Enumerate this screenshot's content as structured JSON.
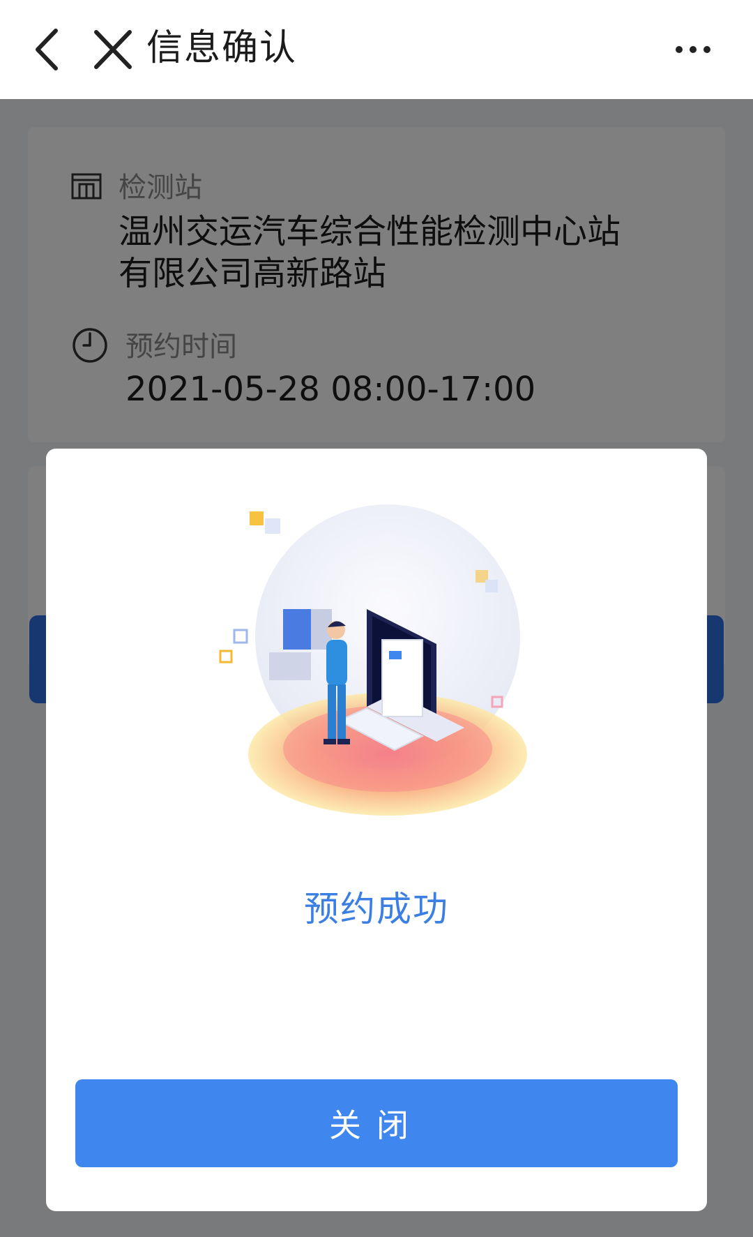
{
  "navbar": {
    "title": "信息确认",
    "back_icon": "chevron-left-icon",
    "close_icon": "close-icon",
    "more_icon": "more-horizontal-icon"
  },
  "card": {
    "station_label": "检测站",
    "station_name_line1": "温州交运汽车综合性能检测中心站",
    "station_name_line2": "有限公司高新路站",
    "time_label": "预约时间",
    "time_value": "2021-05-28 08:00-17:00"
  },
  "modal": {
    "message": "预约成功",
    "close_label": "关闭"
  },
  "colors": {
    "primary": "#3f86ef",
    "success_text": "#3b7fe3",
    "overlay": "rgba(0,0,0,0.5)"
  }
}
